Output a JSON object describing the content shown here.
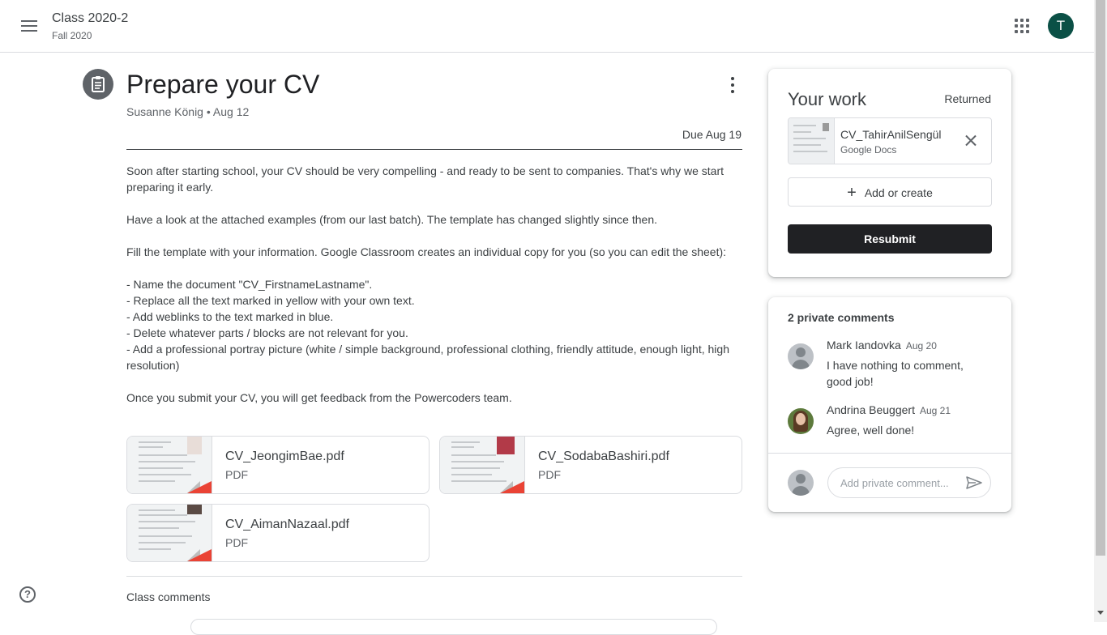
{
  "header": {
    "class_name": "Class 2020-2",
    "class_term": "Fall 2020",
    "user_initial": "T"
  },
  "assignment": {
    "title": "Prepare your CV",
    "author": "Susanne König",
    "posted": "Aug 12",
    "meta_sep": " • ",
    "due": "Due Aug 19",
    "description": [
      "Soon after starting school, your CV should be very compelling - and ready to be sent to companies. That's why we start preparing it early.",
      "Have a look at the attached examples (from our last batch). The template has changed slightly since then.",
      "Fill the template with your information. Google Classroom creates an individual copy for you (so you can edit the sheet):",
      "- Name the document \"CV_FirstnameLastname\".\n- Replace all the text marked in yellow with your own text.\n- Add weblinks to the text marked in blue.\n- Delete whatever parts / blocks are not relevant for you.\n- Add a professional portray picture (white / simple background, professional clothing, friendly attitude, enough light, high resolution)",
      "Once you submit your CV, you will get feedback from the Powercoders team."
    ],
    "attachments": [
      {
        "name": "CV_JeongimBae.pdf",
        "type": "PDF"
      },
      {
        "name": "CV_SodabaBashiri.pdf",
        "type": "PDF"
      },
      {
        "name": "CV_AimanNazaal.pdf",
        "type": "PDF"
      }
    ],
    "class_comments_label": "Class comments"
  },
  "your_work": {
    "title": "Your work",
    "status": "Returned",
    "file": {
      "name": "CV_TahirAnilSengül",
      "type": "Google Docs"
    },
    "add_label": "Add or create",
    "resubmit_label": "Resubmit"
  },
  "private_comments": {
    "title": "2 private comments",
    "comments": [
      {
        "author": "Mark Iandovka",
        "date": "Aug 20",
        "text": "I have nothing to comment, good job!"
      },
      {
        "author": "Andrina Beuggert",
        "date": "Aug 21",
        "text": "Agree, well done!"
      }
    ],
    "input_placeholder": "Add private comment..."
  },
  "colors": {
    "avatar": "#0b5046",
    "resubmit": "#202124",
    "pdf_corner": "#ea4335"
  },
  "icons": [
    "menu-icon",
    "apps-icon",
    "assignment-icon",
    "more-vert-icon",
    "close-icon",
    "add-icon",
    "send-icon",
    "help-icon"
  ]
}
